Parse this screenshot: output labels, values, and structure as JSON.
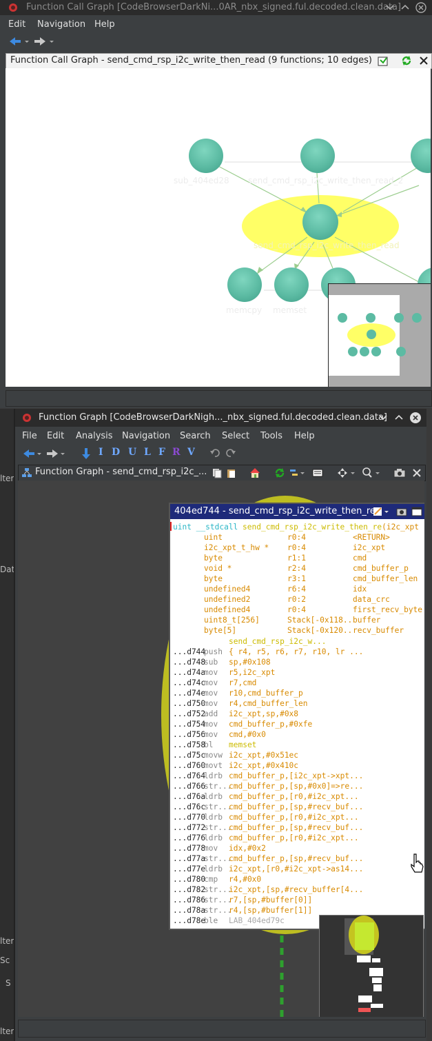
{
  "call_graph_window": {
    "title": "Function Call Graph [CodeBrowserDarkNi...0AR_nbx_signed.ful.decoded.clean.data]",
    "menu": [
      "Edit",
      "Navigation",
      "Help"
    ],
    "panel_title": "Function Call Graph - send_cmd_rsp_i2c_write_then_read (9 functions; 10 edges)",
    "node_labels": {
      "top_left": "sub_404ed28",
      "top_mid": "send_cmd_rsp_i2c_write_then_read_2",
      "center": "send_cmd_rsp_i2c_write_then_read",
      "bottom_1": "memcpy",
      "bottom_2": "memset"
    }
  },
  "function_graph_window": {
    "title": "Function Graph [CodeBrowserDarkNigh..._nbx_signed.ful.decoded.clean.data]",
    "menu": [
      "File",
      "Edit",
      "Analysis",
      "Navigation",
      "Search",
      "Select",
      "Tools",
      "Help"
    ],
    "toolbar_letters": [
      "I",
      "D",
      "U",
      "L",
      "F",
      "R",
      "V"
    ],
    "panel_title": "Function Graph - send_cmd_rsp_i2c_...",
    "block_title": "404ed744 - send_cmd_rsp_i2c_write_then_re",
    "signature": {
      "kw": "uint __stdcall",
      "name": "send_cmd_rsp_i2c_write_then_re",
      "params": "(i2c_xpt"
    },
    "vars": [
      {
        "type": "uint",
        "storage": "r0:4",
        "name": "<RETURN>"
      },
      {
        "type": "i2c_xpt_t_hw *",
        "storage": "r0:4",
        "name": "i2c_xpt"
      },
      {
        "type": "byte",
        "storage": "r1:1",
        "name": "cmd"
      },
      {
        "type": "void *",
        "storage": "r2:4",
        "name": "cmd_buffer_p"
      },
      {
        "type": "byte",
        "storage": "r3:1",
        "name": "cmd_buffer_len"
      },
      {
        "type": "undefined4",
        "storage": "r6:4",
        "name": "idx"
      },
      {
        "type": "undefined2",
        "storage": "r0:2",
        "name": "data_crc"
      },
      {
        "type": "undefined4",
        "storage": "r0:4",
        "name": "first_recv_byte"
      },
      {
        "type": "uint8_t[256]",
        "storage": "Stack[-0x118..",
        "name": "buffer"
      },
      {
        "type": "byte[5]",
        "storage": "Stack[-0x120..",
        "name": "recv_buffer"
      }
    ],
    "func_label": "send_cmd_rsp_i2c_w...",
    "instructions": [
      {
        "addr": "...d744",
        "mn": "push",
        "op": "{ r4, r5, r6, r7, r10, lr ..."
      },
      {
        "addr": "...d748",
        "mn": "sub",
        "op": "sp,#0x108"
      },
      {
        "addr": "...d74a",
        "mn": "mov",
        "op": "r5,i2c_xpt"
      },
      {
        "addr": "...d74c",
        "mn": "mov",
        "op": "r7,cmd"
      },
      {
        "addr": "...d74e",
        "mn": "mov",
        "op": "r10,cmd_buffer_p"
      },
      {
        "addr": "...d750",
        "mn": "mov",
        "op": "r4,cmd_buffer_len"
      },
      {
        "addr": "...d752",
        "mn": "add",
        "op": "i2c_xpt,sp,#0x8"
      },
      {
        "addr": "...d754",
        "mn": "mov",
        "op": "cmd_buffer_p,#0xfe"
      },
      {
        "addr": "...d756",
        "mn": "mov",
        "op": "cmd,#0x0"
      },
      {
        "addr": "...d758",
        "mn": "bl",
        "op": "memset"
      },
      {
        "addr": "...d75c",
        "mn": "movw",
        "op": "i2c_xpt,#0x51ec"
      },
      {
        "addr": "...d760",
        "mn": "movt",
        "op": "i2c_xpt,#0x410c"
      },
      {
        "addr": "...d764",
        "mn": "ldrb",
        "op": "cmd_buffer_p,[i2c_xpt->xpt..."
      },
      {
        "addr": "...d766",
        "mn": "str...",
        "op": "cmd_buffer_p,[sp,#0x0]=>re..."
      },
      {
        "addr": "...d76a",
        "mn": "ldrb",
        "op": "cmd_buffer_p,[r0,#i2c_xpt..."
      },
      {
        "addr": "...d76c",
        "mn": "str...",
        "op": "cmd_buffer_p,[sp,#recv_buf..."
      },
      {
        "addr": "...d770",
        "mn": "ldrb",
        "op": "cmd_buffer_p,[r0,#i2c_xpt..."
      },
      {
        "addr": "...d772",
        "mn": "str...",
        "op": "cmd_buffer_p,[sp,#recv_buf..."
      },
      {
        "addr": "...d776",
        "mn": "ldrb",
        "op": "cmd_buffer_p,[r0,#i2c_xpt..."
      },
      {
        "addr": "...d778",
        "mn": "mov",
        "op": "idx,#0x2"
      },
      {
        "addr": "...d77a",
        "mn": "str...",
        "op": "cmd_buffer_p,[sp,#recv_buf..."
      },
      {
        "addr": "...d77e",
        "mn": "ldrb",
        "op": "i2c_xpt,[r0,#i2c_xpt->as14..."
      },
      {
        "addr": "...d780",
        "mn": "cmp",
        "op": "r4,#0x0"
      },
      {
        "addr": "...d782",
        "mn": "str...",
        "op": "i2c_xpt,[sp,#recv_buffer[4..."
      },
      {
        "addr": "...d786",
        "mn": "str...",
        "op": "r7,[sp,#buffer[0]]"
      },
      {
        "addr": "...d78a",
        "mn": "str...",
        "op": "r4,[sp,#buffer[1]]"
      },
      {
        "addr": "...d78e",
        "mn": "ble",
        "op": "LAB_404ed79c"
      }
    ],
    "left_strip_labels": [
      "lter",
      "Dat",
      "lter",
      "Sc",
      "S",
      "lter"
    ]
  },
  "colors": {
    "node": "#5cbba3",
    "highlight": "#ffff66",
    "listing_header": "#1e2a7a"
  }
}
